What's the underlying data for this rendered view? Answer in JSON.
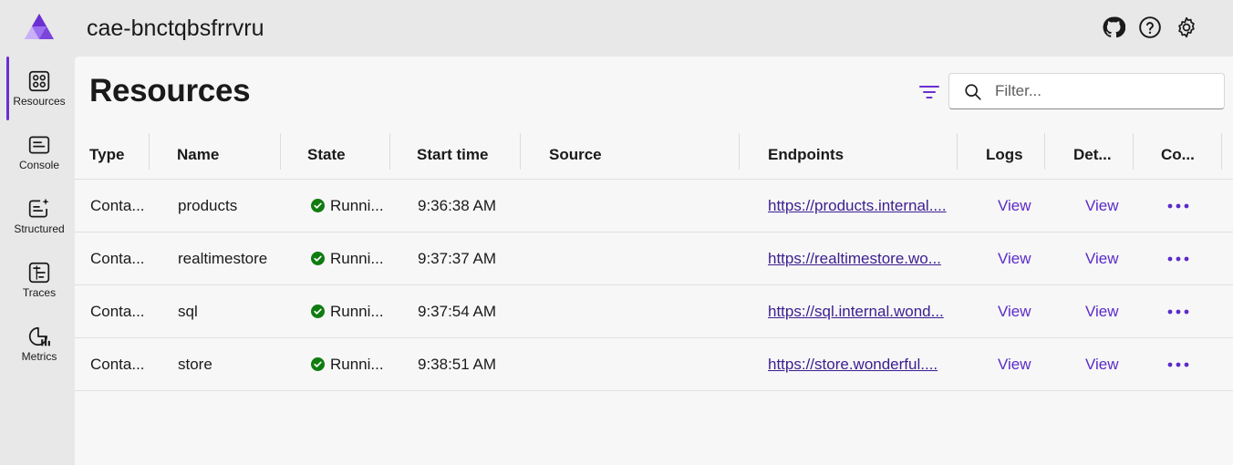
{
  "app": {
    "title": "cae-bnctqbsfrrvru"
  },
  "topbar": {
    "icons": [
      "github-icon",
      "help-icon",
      "settings-icon"
    ]
  },
  "sidebar": {
    "items": [
      {
        "label": "Resources",
        "icon": "resources-icon",
        "active": true
      },
      {
        "label": "Console",
        "icon": "console-icon",
        "active": false
      },
      {
        "label": "Structured",
        "icon": "structured-logs-icon",
        "active": false
      },
      {
        "label": "Traces",
        "icon": "traces-icon",
        "active": false
      },
      {
        "label": "Metrics",
        "icon": "metrics-icon",
        "active": false
      }
    ]
  },
  "page": {
    "title": "Resources"
  },
  "search": {
    "placeholder": "Filter...",
    "value": ""
  },
  "table": {
    "columns": [
      "Type",
      "Name",
      "State",
      "Start time",
      "Source",
      "Endpoints",
      "Logs",
      "Det...",
      "Co..."
    ],
    "rows": [
      {
        "type": "Conta...",
        "name": "products",
        "state": "Runni...",
        "start": "9:36:38 AM",
        "source": "",
        "endpoint": "https://products.internal....",
        "logs": "View",
        "details": "View"
      },
      {
        "type": "Conta...",
        "name": "realtimestore",
        "state": "Runni...",
        "start": "9:37:37 AM",
        "source": "",
        "endpoint": "https://realtimestore.wo...",
        "logs": "View",
        "details": "View"
      },
      {
        "type": "Conta...",
        "name": "sql",
        "state": "Runni...",
        "start": "9:37:54 AM",
        "source": "",
        "endpoint": "https://sql.internal.wond...",
        "logs": "View",
        "details": "View"
      },
      {
        "type": "Conta...",
        "name": "store",
        "state": "Runni...",
        "start": "9:38:51 AM",
        "source": "",
        "endpoint": "https://store.wonderful....",
        "logs": "View",
        "details": "View"
      }
    ]
  },
  "colors": {
    "accent": "#6b2fd1",
    "running": "#107c10",
    "link": "#3b1e8f"
  }
}
